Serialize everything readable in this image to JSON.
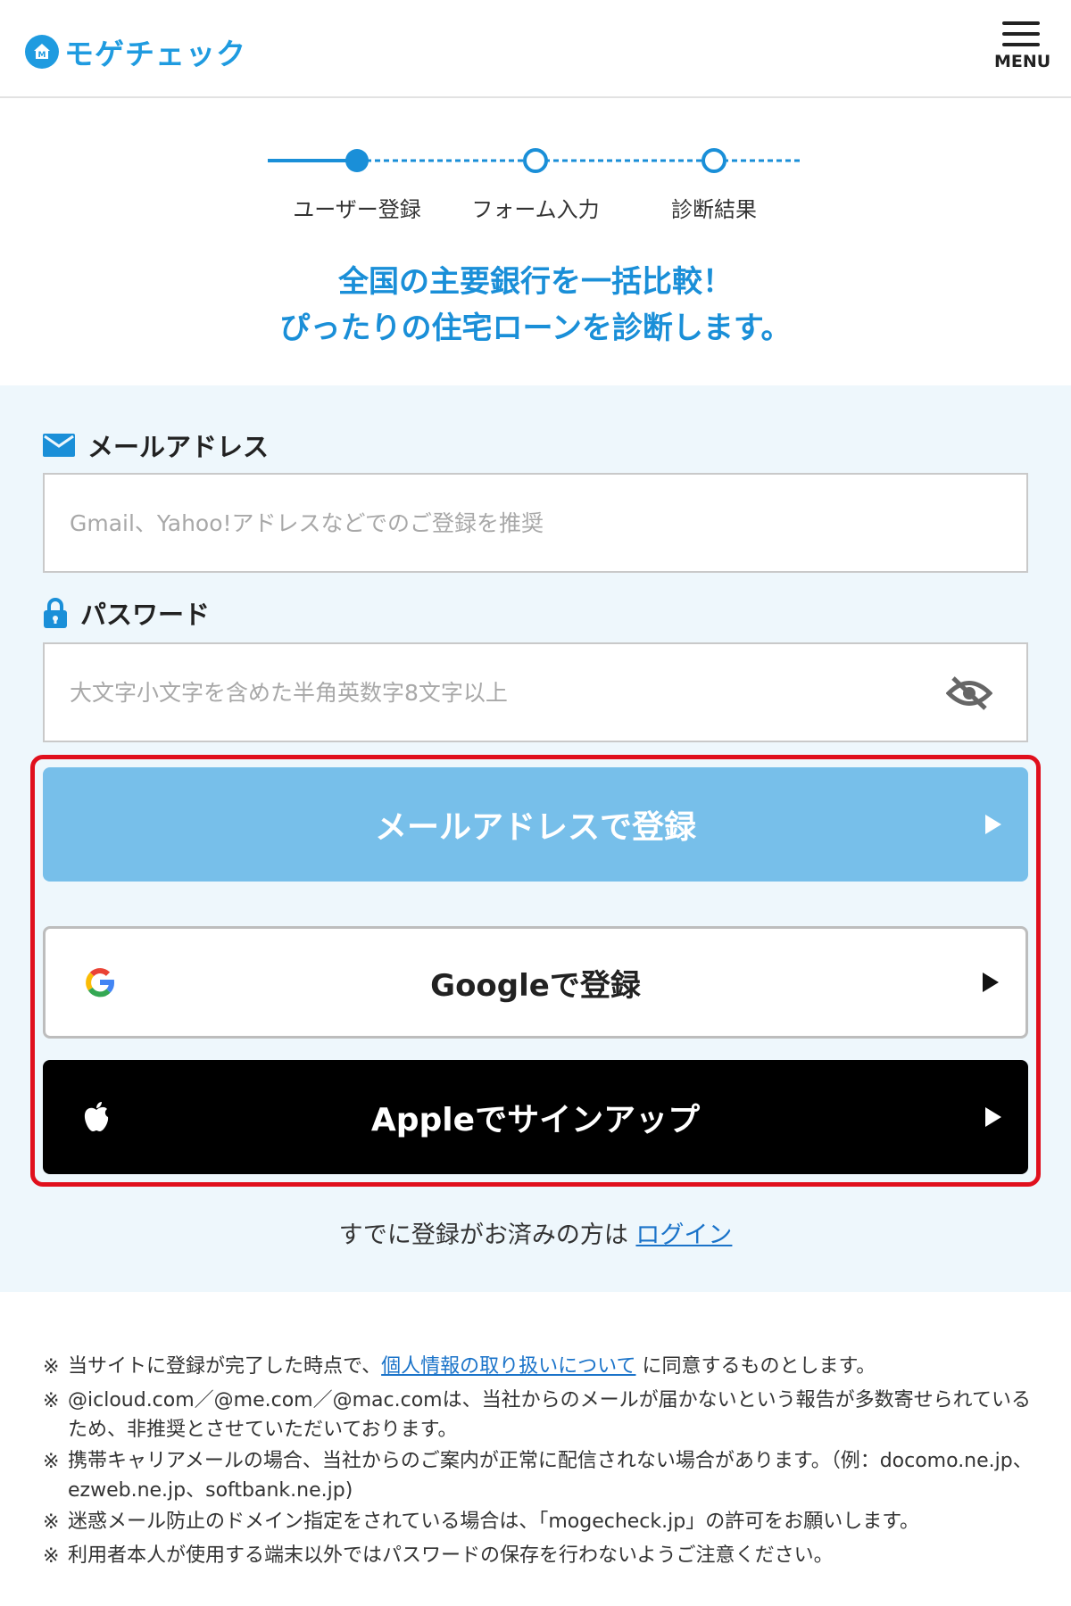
{
  "header": {
    "logo_text": "モゲチェック",
    "menu_label": "MENU"
  },
  "progress": {
    "current_step": 1,
    "steps": [
      {
        "label": "ユーザー登録"
      },
      {
        "label": "フォーム入力"
      },
      {
        "label": "診断結果"
      }
    ]
  },
  "headline": {
    "line1": "全国の主要銀行を一括比較！",
    "line2": "ぴったりの住宅ローンを診断します。"
  },
  "form": {
    "email": {
      "label": "メールアドレス",
      "value": "",
      "placeholder": "Gmail、Yahoo!アドレスなどでのご登録を推奨"
    },
    "password": {
      "label": "パスワード",
      "value": "",
      "placeholder": "大文字小文字を含めた半角英数字8文字以上"
    }
  },
  "buttons": {
    "email_register": "メールアドレスで登録",
    "google_register": "Googleで登録",
    "apple_signup": "Appleでサインアップ"
  },
  "login": {
    "prefix": "すでに登録がお済みの方は ",
    "link": "ログイン"
  },
  "notes": {
    "mark": "※",
    "n1_before": "当サイトに登録が完了した時点で、",
    "n1_link": "個人情報の取り扱いについて",
    "n1_after": " に同意するものとします。",
    "n2": "@icloud.com／@me.com／@mac.comは、当社からのメールが届かないという報告が多数寄せられているため、非推奨とさせていただいております。",
    "n3": "携帯キャリアメールの場合、当社からのご案内が正常に配信されない場合があります。（例：docomo.ne.jp、ezweb.ne.jp、softbank.ne.jp)",
    "n4": "迷惑メール防止のドメイン指定をされている場合は、「mogecheck.jp」の許可をお願いします。",
    "n5": "利用者本人が使用する端末以外ではパスワードの保存を行わないようご注意ください。"
  },
  "colors": {
    "brand": "#1f9be0",
    "email_button": "#77bfea",
    "highlight_frame": "#e0101d",
    "panel_bg": "#eef7fc"
  }
}
